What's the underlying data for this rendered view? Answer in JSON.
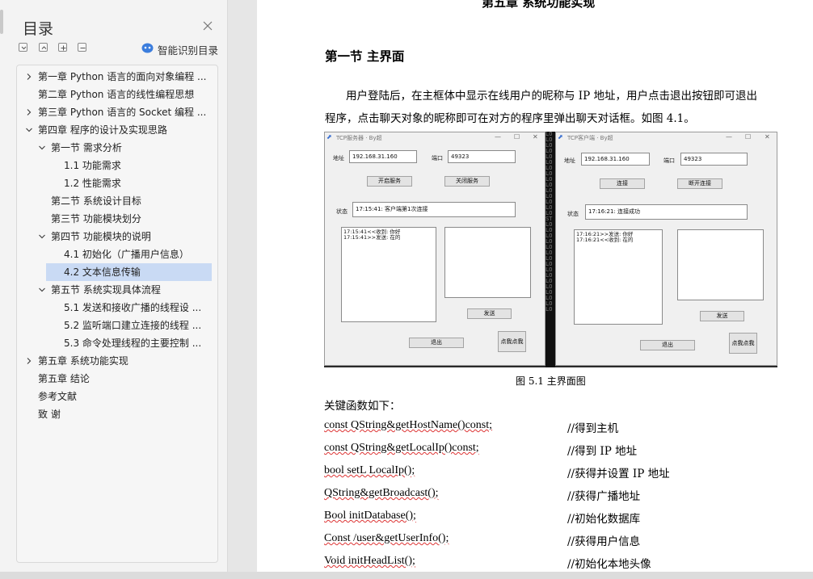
{
  "sidebar": {
    "title": "目录",
    "smart_toc_label": "智能识别目录",
    "toc": [
      {
        "label": "第一章  Python 语言的面向对象编程 ...",
        "level": 0,
        "toggle": "collapsed"
      },
      {
        "label": "第二章  Python 语言的线性编程思想",
        "level": 0,
        "toggle": "none"
      },
      {
        "label": "第三章  Python 语言的 Socket 编程 ...",
        "level": 0,
        "toggle": "collapsed"
      },
      {
        "label": "第四章  程序的设计及实现思路",
        "level": 0,
        "toggle": "expanded"
      },
      {
        "label": "第一节  需求分析",
        "level": 1,
        "toggle": "expanded"
      },
      {
        "label": "1.1 功能需求",
        "level": 2,
        "toggle": "none"
      },
      {
        "label": "1.2 性能需求",
        "level": 2,
        "toggle": "none"
      },
      {
        "label": "第二节  系统设计目标",
        "level": 1,
        "toggle": "none"
      },
      {
        "label": "第三节  功能模块划分",
        "level": 1,
        "toggle": "none"
      },
      {
        "label": "第四节  功能模块的说明",
        "level": 1,
        "toggle": "expanded"
      },
      {
        "label": "4.1  初始化（广播用户信息）",
        "level": 2,
        "toggle": "none"
      },
      {
        "label": "4.2  文本信息传输",
        "level": 2,
        "toggle": "none",
        "selected": true
      },
      {
        "label": "第五节  系统实现具体流程",
        "level": 1,
        "toggle": "expanded"
      },
      {
        "label": "5.1  发送和接收广播的线程设 ...",
        "level": 2,
        "toggle": "none"
      },
      {
        "label": "5.2  监听端口建立连接的线程 ...",
        "level": 2,
        "toggle": "none"
      },
      {
        "label": "5.3  命令处理线程的主要控制 ...",
        "level": 2,
        "toggle": "none"
      },
      {
        "label": "第五章  系统功能实现",
        "level": 0,
        "toggle": "collapsed"
      },
      {
        "label": "第五章  结论",
        "level": 0,
        "toggle": "none"
      },
      {
        "label": "参考文献",
        "level": 0,
        "toggle": "none"
      },
      {
        "label": "致    谢",
        "level": 0,
        "toggle": "none"
      }
    ]
  },
  "document": {
    "chapter_heading_partial": "第五章  系统功能实现",
    "section_title": "第一节  主界面",
    "paragraph_line1": "用户登陆后，在主框体中显示在线用户的昵称与 IP 地址，用户点击退出按钮即可退出",
    "paragraph_line2": "程序，点击聊天对象的昵称即可在对方的程序里弹出聊天对话框。如图 4.1。",
    "figure_caption": "图 5.1  主界面图",
    "key_functions_intro": "关键函数如下：",
    "code_lines": [
      {
        "code": "const QString&getHostName()const;",
        "comment": "//得到主机"
      },
      {
        "code": "const QString&getLocalIp()const;",
        "comment": "//得到 IP 地址"
      },
      {
        "code": "bool setL LocalIp();",
        "comment": "//获得并设置 IP 地址"
      },
      {
        "code": "QString&getBroadcast();",
        "comment": "//获得广播地址"
      },
      {
        "code": "Bool initDatabase();",
        "comment": "//初始化数据库"
      },
      {
        "code": "Const /user&getUserInfo();",
        "comment": " //获得用户信息"
      },
      {
        "code": "Void initHeadList();",
        "comment": "//初始化本地头像"
      }
    ]
  },
  "figure": {
    "server": {
      "title": "TCP服务器 · By超",
      "addr_label": "地址",
      "addr_value": "192.168.31.160",
      "port_label": "端口",
      "port_value": "49323",
      "start_btn": "开启服务",
      "stop_btn": "关闭服务",
      "status_label": "状态",
      "status_value": "17:15:41: 客户端第1次连接",
      "log_line1": "17:15:41<<收到: 你好",
      "log_line2": "17:15:41>>发送: 在的",
      "send_btn": "发送",
      "exit_btn": "退出",
      "poke_btn": "点我点我"
    },
    "client": {
      "title": "TCP客户端 · By超",
      "addr_label": "地址",
      "addr_value": "192.168.31.160",
      "port_label": "端口",
      "port_value": "49323",
      "connect_btn": "连接",
      "disconnect_btn": "断开连接",
      "status_label": "状态",
      "status_value": "17:16:21: 连接成功",
      "log_line1": "17:16:21>>发送: 你好",
      "log_line2": "17:16:21<<收到: 在的",
      "send_btn": "发送",
      "exit_btn": "退出",
      "poke_btn": "点我点我"
    },
    "terminal_text": "LO LO LO LO LO LO LO LO LO LO LO LO LO LO LO ST LO LO LO LO LO LO LO LO LO LO LO LO LO LO LO LO"
  }
}
